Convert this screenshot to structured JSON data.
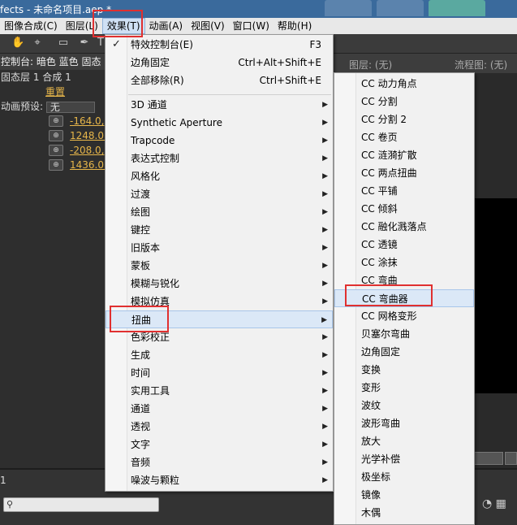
{
  "window": {
    "title": "fects - 未命名项目.aep *"
  },
  "menubar": {
    "items": [
      "图像合成(C)",
      "图层(L)",
      "效果(T)",
      "动画(A)",
      "视图(V)",
      "窗口(W)",
      "帮助(H)"
    ]
  },
  "left_panel": {
    "header": "控制台: 暗色 蓝色 固态",
    "layer": "固态层 1 合成 1",
    "reset": "重置",
    "preset_label": "动画预设:",
    "preset_value": "无",
    "values": [
      "-164.0,",
      "1248.0,",
      "-208.0,",
      "1436.0,"
    ]
  },
  "right_panel": {
    "layer_label": "图层: (无)",
    "flow_label": "流程图: (无)"
  },
  "bottom": {
    "tab_number": "1"
  },
  "effects_menu": {
    "top": [
      {
        "label": "特效控制台(E)",
        "shortcut": "F3",
        "checked": true
      },
      {
        "label": "边角固定",
        "shortcut": "Ctrl+Alt+Shift+E"
      },
      {
        "label": "全部移除(R)",
        "shortcut": "Ctrl+Shift+E"
      }
    ],
    "categories": [
      "3D 通道",
      "Synthetic Aperture",
      "Trapcode",
      "表达式控制",
      "风格化",
      "过渡",
      "绘图",
      "键控",
      "旧版本",
      "蒙板",
      "模糊与锐化",
      "模拟仿真",
      "扭曲",
      "色彩校正",
      "生成",
      "时间",
      "实用工具",
      "通道",
      "透视",
      "文字",
      "音频",
      "噪波与颗粒"
    ],
    "highlighted": "扭曲"
  },
  "distort_submenu": {
    "items": [
      "CC 动力角点",
      "CC 分割",
      "CC 分割 2",
      "CC 卷页",
      "CC 涟漪扩散",
      "CC 两点扭曲",
      "CC 平铺",
      "CC 倾斜",
      "CC 融化溅落点",
      "CC 透镜",
      "CC 涂抹",
      "CC 弯曲",
      "CC 弯曲器",
      "CC 网格变形",
      "贝塞尔弯曲",
      "边角固定",
      "变换",
      "变形",
      "波纹",
      "波形弯曲",
      "放大",
      "光学补偿",
      "极坐标",
      "镜像",
      "木偶"
    ],
    "highlighted": "CC 弯曲器"
  }
}
